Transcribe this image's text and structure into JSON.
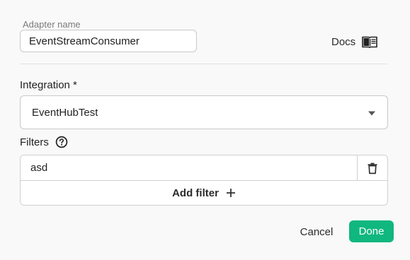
{
  "adapter": {
    "label": "Adapter name",
    "value": "EventStreamConsumer"
  },
  "docs": {
    "label": "Docs",
    "icon": "book-open-icon"
  },
  "integration": {
    "label": "Integration *",
    "selected": "EventHubTest",
    "caret_icon": "caret-down-icon"
  },
  "filters": {
    "label": "Filters",
    "help_icon": "help-circle-icon",
    "items": [
      {
        "value": "asd",
        "delete_icon": "trash-icon"
      }
    ],
    "add_label": "Add filter",
    "add_icon": "plus-icon"
  },
  "actions": {
    "cancel_label": "Cancel",
    "done_label": "Done"
  },
  "colors": {
    "primary": "#10b77f",
    "background": "#f9f9f9",
    "border": "#c8c8c8"
  }
}
